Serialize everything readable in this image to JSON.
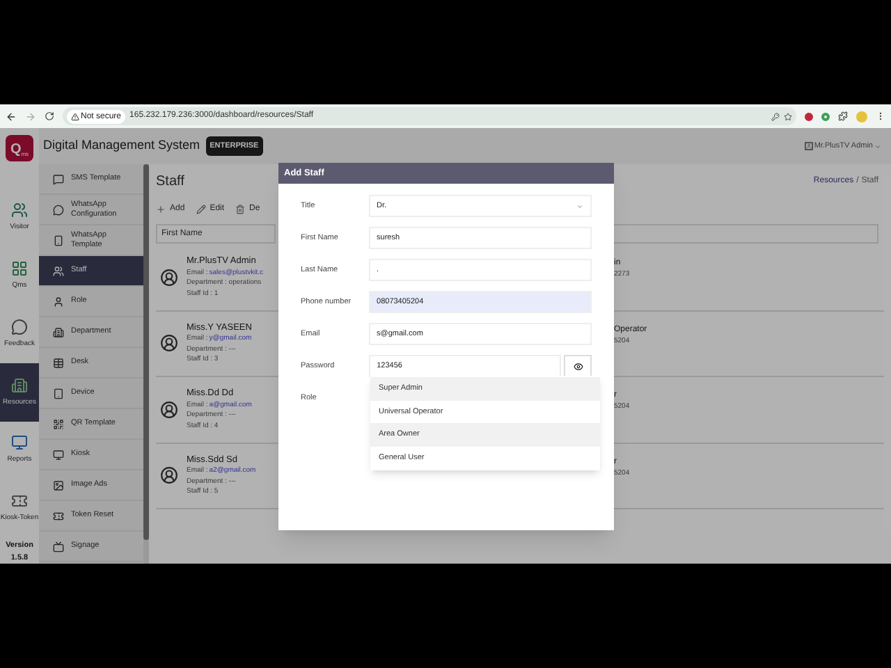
{
  "browser": {
    "security": "Not secure",
    "url": "165.232.179.236:3000/dashboard/resources/Staff"
  },
  "app": {
    "logo_main": "Q",
    "logo_sub": "ms",
    "title": "Digital Management System",
    "badge": "ENTERPRISE",
    "user": "Mr.PlusTV Admin"
  },
  "rail": [
    {
      "label": "Visitor",
      "selected": false
    },
    {
      "label": "Qms",
      "selected": false
    },
    {
      "label": "Feedback",
      "selected": false
    },
    {
      "label": "Resources",
      "selected": true
    },
    {
      "label": "Reports",
      "selected": false
    },
    {
      "label": "Kiosk-Token",
      "selected": false
    }
  ],
  "version": {
    "label": "Version",
    "number": "1.5.8"
  },
  "submenu": [
    {
      "label": "SMS Template",
      "selected": false
    },
    {
      "label": "WhatsApp Configuration",
      "selected": false
    },
    {
      "label": "WhatsApp Template",
      "selected": false
    },
    {
      "label": "Staff",
      "selected": true
    },
    {
      "label": "Role",
      "selected": false
    },
    {
      "label": "Department",
      "selected": false
    },
    {
      "label": "Desk",
      "selected": false
    },
    {
      "label": "Device",
      "selected": false
    },
    {
      "label": "QR Template",
      "selected": false
    },
    {
      "label": "Kiosk",
      "selected": false
    },
    {
      "label": "Image Ads",
      "selected": false
    },
    {
      "label": "Token Reset",
      "selected": false
    },
    {
      "label": "Signage",
      "selected": false
    }
  ],
  "page": {
    "title": "Staff",
    "breadcrumb": [
      "Resources",
      "Staff"
    ],
    "separator": "/",
    "toolbar": [
      "Add",
      "Edit",
      "De"
    ],
    "filter": "First Name"
  },
  "staff": [
    {
      "name": "Mr.PlusTV Admin",
      "email_label": "Email :",
      "email": "sales@plustvkit.c",
      "department": "Department : operations",
      "staff_id": "Staff Id : 1",
      "column_2": [
        "in",
        "2273"
      ]
    },
    {
      "name": "Miss.Y YASEEN",
      "email_label": "Email :",
      "email": "y@gmail.com",
      "department": "Department : ---",
      "staff_id": "Staff Id : 3",
      "column_2": [
        "Operator",
        "5204"
      ]
    },
    {
      "name": "Miss.Dd Dd",
      "email_label": "Email :",
      "email": "a@gmail.com",
      "department": "Department : ---",
      "staff_id": "Staff Id : 4",
      "column_2": [
        "r",
        "5204"
      ]
    },
    {
      "name": "Miss.Sdd Sd",
      "email_label": "Email :",
      "email": "a2@gmail.com",
      "department": "Department : ---",
      "staff_id": "Staff Id : 5",
      "column_2": [
        "r",
        "5204"
      ]
    }
  ],
  "dialog": {
    "title": "Add Staff",
    "fields": [
      {
        "label": "Title",
        "kind": "select",
        "value": "Dr."
      },
      {
        "label": "First Name",
        "kind": "text",
        "value": "suresh"
      },
      {
        "label": "Last Name",
        "kind": "text",
        "value": "."
      },
      {
        "label": "Phone number",
        "kind": "text",
        "value": "08073405204",
        "autofilled": true
      },
      {
        "label": "Email",
        "kind": "text",
        "value": "s@gmail.com"
      },
      {
        "label": "Password",
        "kind": "password",
        "value": "123456"
      },
      {
        "label": "Role",
        "kind": "dropdown",
        "options": [
          {
            "label": "Super Admin",
            "highlighted": true
          },
          {
            "label": "Universal Operator",
            "highlighted": false
          },
          {
            "label": "Area Owner",
            "highlighted": true
          },
          {
            "label": "General User",
            "highlighted": false
          }
        ]
      }
    ]
  }
}
